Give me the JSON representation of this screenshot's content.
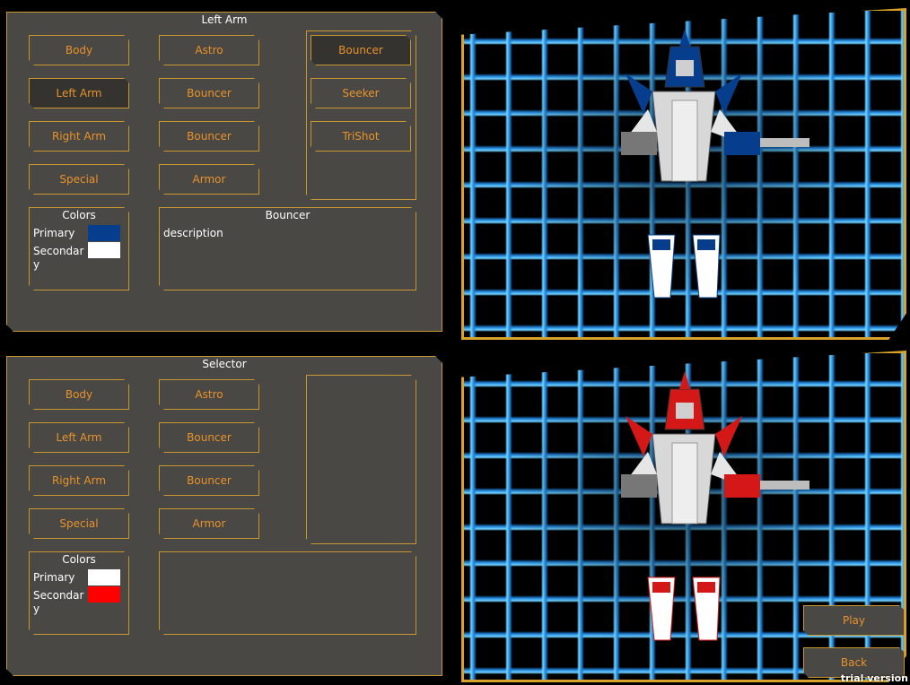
{
  "top_panel": {
    "title": "Left Arm",
    "col1": [
      "Body",
      "Left Arm",
      "Right Arm",
      "Special"
    ],
    "col2": [
      "Astro",
      "Bouncer",
      "Bouncer",
      "Armor"
    ],
    "options": [
      "Bouncer",
      "Seeker",
      "TriShot"
    ],
    "colors_title": "Colors",
    "primary_label": "Primary",
    "secondary_label": "Secondary",
    "primary_color": "#063d8c",
    "secondary_color": "#ffffff",
    "info_title": "Bouncer",
    "info_desc": "description"
  },
  "bottom_panel": {
    "title": "Selector",
    "col1": [
      "Body",
      "Left Arm",
      "Right Arm",
      "Special"
    ],
    "col2": [
      "Astro",
      "Bouncer",
      "Bouncer",
      "Armor"
    ],
    "colors_title": "Colors",
    "primary_label": "Primary",
    "secondary_label": "Secondary",
    "primary_color": "#ffffff",
    "secondary_color": "#ff0000"
  },
  "nav": {
    "play": "Play",
    "back": "Back"
  },
  "watermark": "trial version",
  "robot_top_colors": {
    "primary": "#063d8c",
    "secondary": "#ffffff"
  },
  "robot_bottom_colors": {
    "primary": "#d41818",
    "secondary": "#ffffff"
  }
}
